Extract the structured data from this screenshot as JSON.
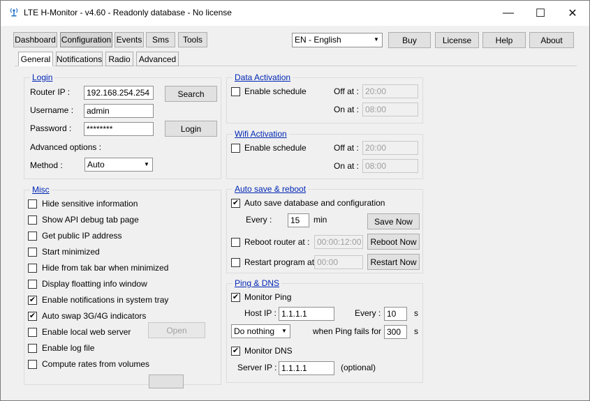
{
  "window": {
    "title": "LTE H-Monitor - v4.60 - Readonly database - No license"
  },
  "window_controls": {
    "minimize": "—",
    "maximize": "☐",
    "close": "✕"
  },
  "main_tabs": [
    "Dashboard",
    "Configuration",
    "Events",
    "Sms",
    "Tools"
  ],
  "language": {
    "selected": "EN - English"
  },
  "top_buttons": {
    "buy": "Buy",
    "license": "License",
    "help": "Help",
    "about": "About"
  },
  "sub_tabs": [
    "General",
    "Notifications",
    "Radio",
    "Advanced"
  ],
  "login": {
    "title": "Login",
    "router_ip_label": "Router IP :",
    "router_ip": "192.168.254.254",
    "search": "Search",
    "username_label": "Username :",
    "username": "admin",
    "password_label": "Password :",
    "password": "********",
    "login_button": "Login",
    "advanced_options": "Advanced options :",
    "method_label": "Method :",
    "method": "Auto"
  },
  "data_activation": {
    "title": "Data Activation",
    "enable": "Enable schedule",
    "off_label": "Off at :",
    "off": "20:00",
    "on_label": "On at :",
    "on": "08:00"
  },
  "wifi_activation": {
    "title": "Wifi Activation",
    "enable": "Enable schedule",
    "off_label": "Off at :",
    "off": "20:00",
    "on_label": "On at :",
    "on": "08:00"
  },
  "misc": {
    "title": "Misc",
    "items": [
      {
        "label": "Hide sensitive information",
        "checked": ""
      },
      {
        "label": "Show API debug tab page",
        "checked": ""
      },
      {
        "label": "Get public IP address",
        "checked": ""
      },
      {
        "label": "Start minimized",
        "checked": ""
      },
      {
        "label": "Hide from tak bar when minimized",
        "checked": ""
      },
      {
        "label": "Display floatting info window",
        "checked": ""
      },
      {
        "label": "Enable notifications in system tray",
        "checked": "✔"
      },
      {
        "label": "Auto swap 3G/4G indicators",
        "checked": "✔"
      },
      {
        "label": "Enable local web server",
        "checked": ""
      },
      {
        "label": "Enable log file",
        "checked": ""
      },
      {
        "label": "Compute rates from volumes",
        "checked": ""
      }
    ],
    "open_button": "Open"
  },
  "autosave": {
    "title": "Auto save & reboot",
    "autosave_label": "Auto save database and configuration",
    "autosave_checked": "✔",
    "every_label": "Every :",
    "every": "15",
    "min": "min",
    "save_now": "Save Now",
    "reboot_label": "Reboot router at :",
    "reboot_time": "00:00:12:00",
    "reboot_now": "Reboot Now",
    "restart_label": "Restart program at :",
    "restart_time": "00:00",
    "restart_now": "Restart Now"
  },
  "ping": {
    "title": "Ping & DNS",
    "monitor_ping": "Monitor Ping",
    "monitor_ping_checked": "✔",
    "host_label": "Host IP :",
    "host": "1.1.1.1",
    "every_label": "Every :",
    "every": "10",
    "s": "s",
    "action": "Do nothing",
    "fails_label": "when Ping fails for :",
    "fails": "300",
    "s2": "s",
    "monitor_dns": "Monitor DNS",
    "monitor_dns_checked": "✔",
    "server_label": "Server IP :",
    "server": "1.1.1.1",
    "optional": "(optional)"
  }
}
